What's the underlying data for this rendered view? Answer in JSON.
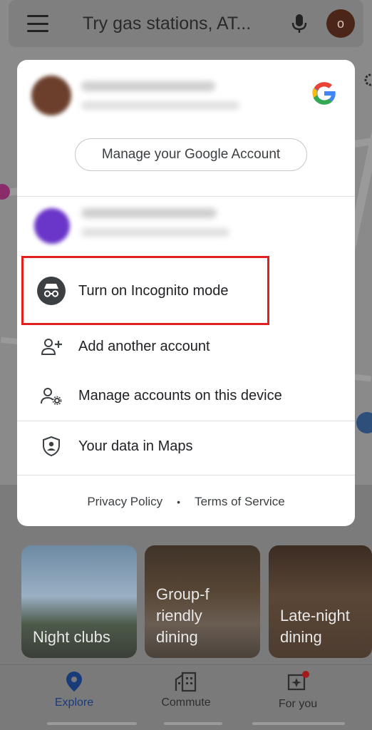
{
  "search": {
    "placeholder": "Try gas stations, AT..."
  },
  "profile": {
    "initial": "o"
  },
  "card": {
    "manage_account_label": "Manage your Google Account",
    "menu": [
      {
        "label": "Turn on Incognito mode",
        "icon": "incognito-icon"
      },
      {
        "label": "Add another account",
        "icon": "add-person-icon"
      },
      {
        "label": "Manage accounts on this device",
        "icon": "manage-accounts-icon"
      },
      {
        "label": "Your data in Maps",
        "icon": "shield-person-icon"
      }
    ],
    "footer": {
      "privacy": "Privacy Policy",
      "separator": "•",
      "terms": "Terms of Service"
    }
  },
  "tiles": [
    {
      "label": "Night clubs"
    },
    {
      "label": "Group-f riendly dining"
    },
    {
      "label": "Late-night dining"
    }
  ],
  "bottom_nav": [
    {
      "label": "Explore",
      "icon": "location-pin-icon",
      "active": true
    },
    {
      "label": "Commute",
      "icon": "city-icon",
      "active": false
    },
    {
      "label": "For you",
      "icon": "sparkle-icon",
      "active": false
    }
  ],
  "colors": {
    "accent": "#1a73e8",
    "highlight_border": "#e02020",
    "avatar_primary": "#6b3f2c",
    "avatar_secondary": "#6a35c9"
  }
}
